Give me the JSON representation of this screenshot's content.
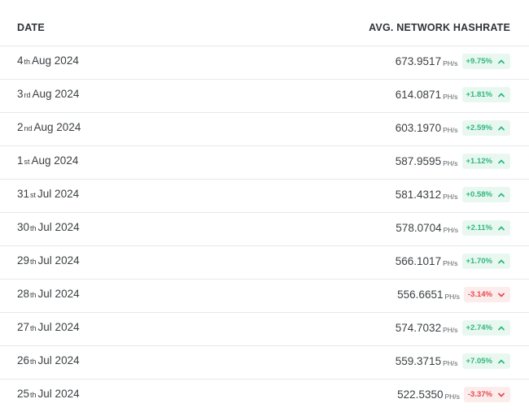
{
  "header": {
    "date_label": "DATE",
    "hashrate_label": "AVG. NETWORK HASHRATE"
  },
  "rows": [
    {
      "day": "4",
      "ordinal": "th",
      "month_year": "Aug 2024",
      "value": "673.9517",
      "unit": "PH/s",
      "change": "+9.75%",
      "direction": "up"
    },
    {
      "day": "3",
      "ordinal": "rd",
      "month_year": "Aug 2024",
      "value": "614.0871",
      "unit": "PH/s",
      "change": "+1.81%",
      "direction": "up"
    },
    {
      "day": "2",
      "ordinal": "nd",
      "month_year": "Aug 2024",
      "value": "603.1970",
      "unit": "PH/s",
      "change": "+2.59%",
      "direction": "up"
    },
    {
      "day": "1",
      "ordinal": "st",
      "month_year": "Aug 2024",
      "value": "587.9595",
      "unit": "PH/s",
      "change": "+1.12%",
      "direction": "up"
    },
    {
      "day": "31",
      "ordinal": "st",
      "month_year": "Jul 2024",
      "value": "581.4312",
      "unit": "PH/s",
      "change": "+0.58%",
      "direction": "up"
    },
    {
      "day": "30",
      "ordinal": "th",
      "month_year": "Jul 2024",
      "value": "578.0704",
      "unit": "PH/s",
      "change": "+2.11%",
      "direction": "up"
    },
    {
      "day": "29",
      "ordinal": "th",
      "month_year": "Jul 2024",
      "value": "566.1017",
      "unit": "PH/s",
      "change": "+1.70%",
      "direction": "up"
    },
    {
      "day": "28",
      "ordinal": "th",
      "month_year": "Jul 2024",
      "value": "556.6651",
      "unit": "PH/s",
      "change": "-3.14%",
      "direction": "down"
    },
    {
      "day": "27",
      "ordinal": "th",
      "month_year": "Jul 2024",
      "value": "574.7032",
      "unit": "PH/s",
      "change": "+2.74%",
      "direction": "up"
    },
    {
      "day": "26",
      "ordinal": "th",
      "month_year": "Jul 2024",
      "value": "559.3715",
      "unit": "PH/s",
      "change": "+7.05%",
      "direction": "up"
    },
    {
      "day": "25",
      "ordinal": "th",
      "month_year": "Jul 2024",
      "value": "522.5350",
      "unit": "PH/s",
      "change": "-3.37%",
      "direction": "down"
    }
  ],
  "colors": {
    "up_text": "#2fb77a",
    "up_bg": "#e8f8f1",
    "down_text": "#e5484d",
    "down_bg": "#fdecec",
    "divider": "#e6e8ec"
  },
  "icons": {
    "up": "chevron-up-icon",
    "down": "chevron-down-icon"
  }
}
